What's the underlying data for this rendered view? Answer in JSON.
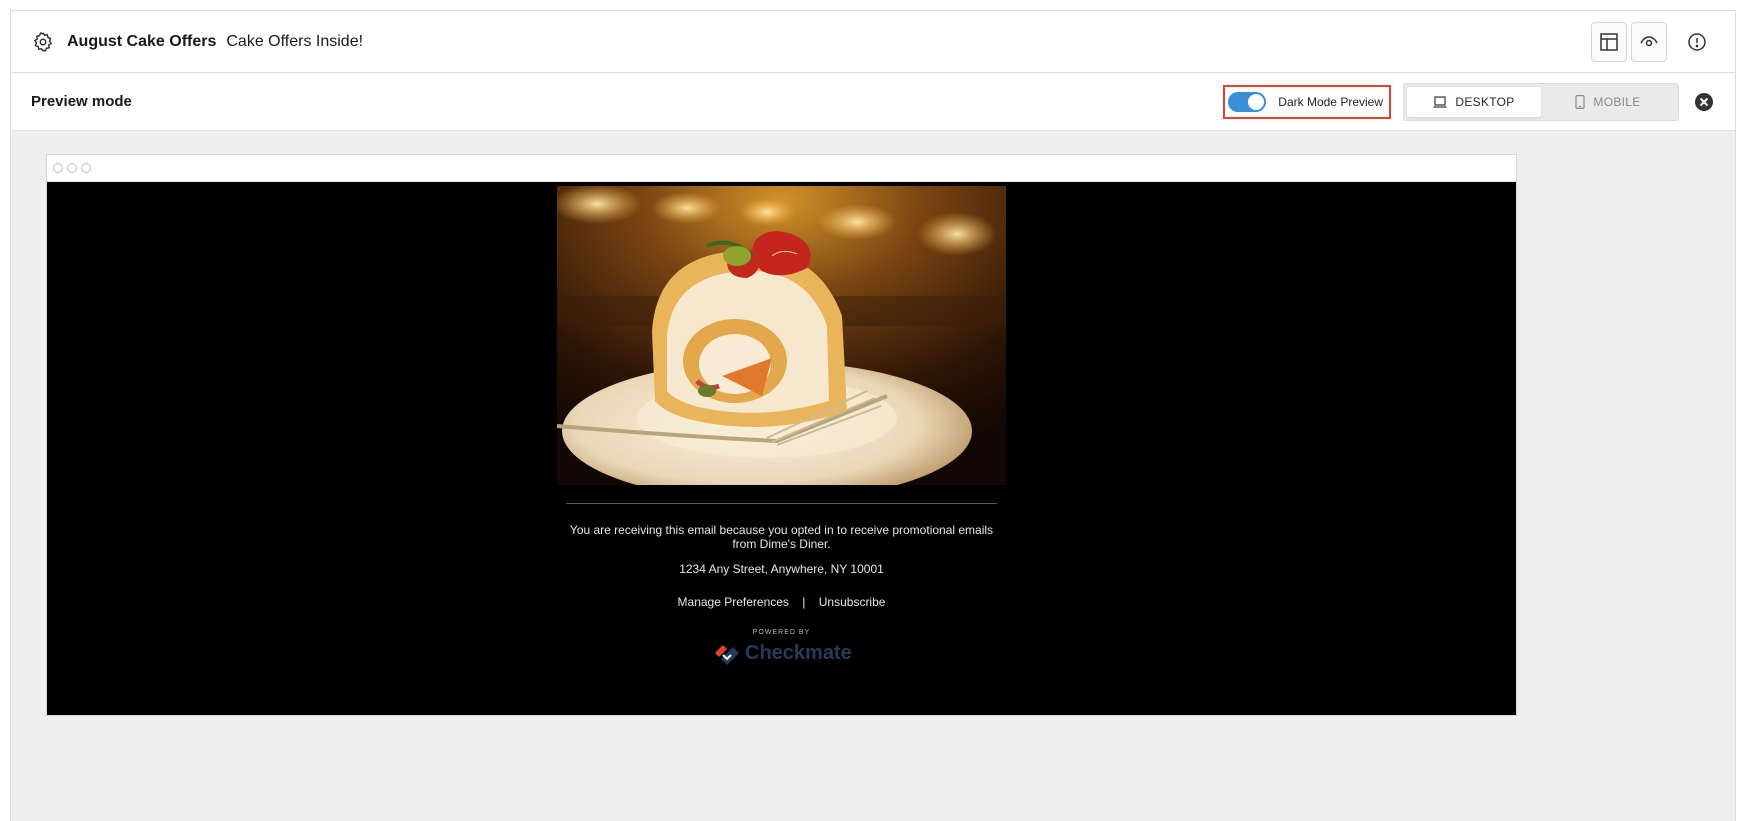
{
  "header": {
    "title": "August Cake Offers",
    "subtitle": "Cake Offers Inside!"
  },
  "preview_bar": {
    "label": "Preview mode",
    "dark_mode_label": "Dark Mode Preview",
    "dark_mode_on": true,
    "devices": [
      {
        "label": "DESKTOP",
        "icon": "laptop-icon",
        "active": true
      },
      {
        "label": "MOBILE",
        "icon": "phone-icon",
        "active": false
      }
    ]
  },
  "email": {
    "hero_alt": "cake-roll-photo",
    "footer_text": "You are receiving this email because you opted in to receive promotional emails from Dime's Diner.",
    "address": "1234 Any Street, Anywhere, NY 10001",
    "manage_label": "Manage Preferences",
    "separator": "|",
    "unsubscribe_label": "Unsubscribe",
    "powered_by": "POWERED BY",
    "brand": "Checkmate"
  },
  "colors": {
    "accent": "#3b8fd9",
    "highlight": "#e2412b",
    "brand_red": "#e2412b",
    "brand_navy": "#263a5a"
  }
}
